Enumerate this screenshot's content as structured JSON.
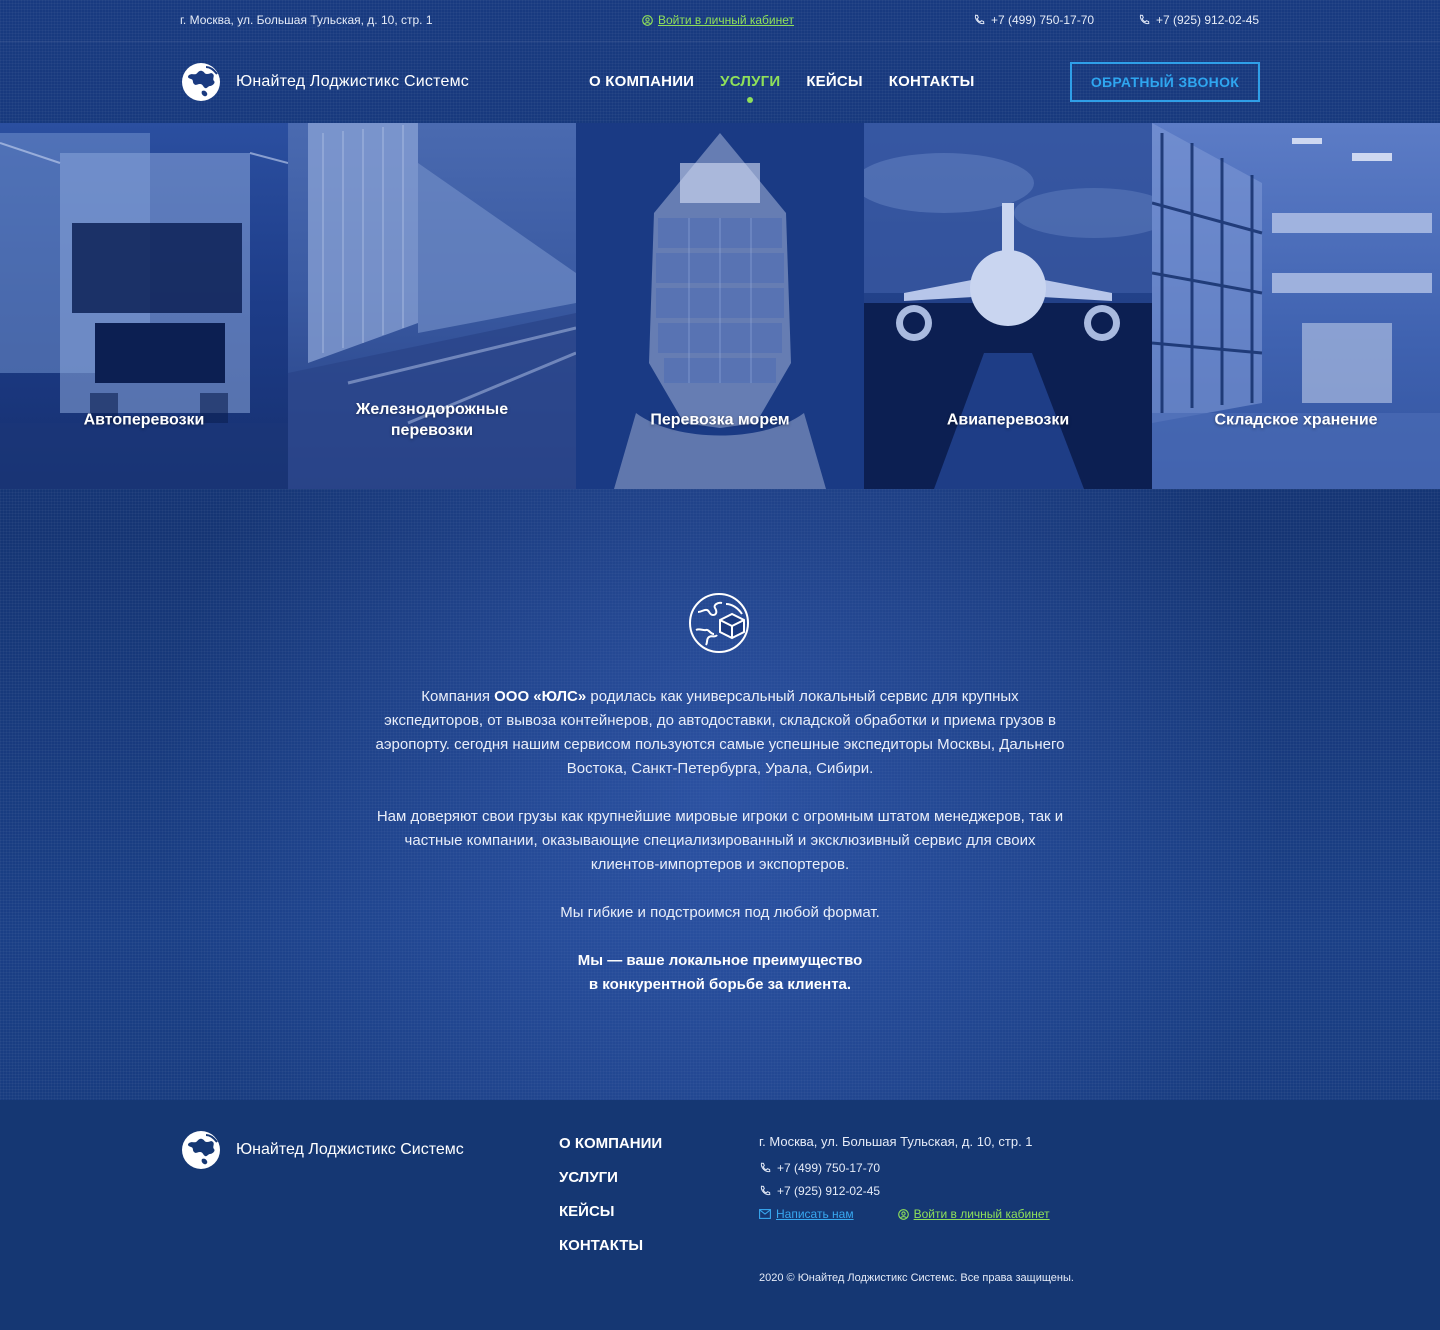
{
  "topbar": {
    "address": "г. Москва, ул. Большая Тульская, д. 10, стр. 1",
    "cabinet_link": "Войти в личный кабинет",
    "phone1": "+7 (499) 750-17-70",
    "phone2": "+7 (925) 912-02-45"
  },
  "header": {
    "logo_text": "Юнайтед Лоджистикс Системс",
    "nav": [
      {
        "label": "О компании",
        "active": false
      },
      {
        "label": "Услуги",
        "active": true
      },
      {
        "label": "Кейсы",
        "active": false
      },
      {
        "label": "Контакты",
        "active": false
      }
    ],
    "callback_label": "Обратный звонок"
  },
  "services": [
    {
      "label": "Автоперевозки"
    },
    {
      "label": "Железнодорожные перевозки"
    },
    {
      "label": "Перевозка морем"
    },
    {
      "label": "Авиаперевозки"
    },
    {
      "label": "Складское хранение"
    }
  ],
  "about": {
    "p1_before": "Компания ",
    "p1_bold": "ООО «ЮЛС»",
    "p1_after": " родилась как универсальный локальный сервис для крупных экспедиторов, от вывоза контейнеров, до автодоставки, складской обработки и приема грузов в аэропорту. сегодня нашим сервисом пользуются самые успешные экспедиторы Москвы, Дальнего Востока, Санкт-Петербурга, Урала, Сибири.",
    "p2": "Нам доверяют свои грузы как крупнейшие мировые игроки с огромным штатом менеджеров, так и частные компании, оказывающие специализированный и эксклюзивный сервис для своих клиентов-импортеров и экспортеров.",
    "p3": "Мы гибкие и подстроимся под любой формат.",
    "p4_line1": "Мы — ваше локальное преимущество",
    "p4_line2": "в конкурентной борьбе за клиента."
  },
  "footer": {
    "logo_text": "Юнайтед Лоджистикс Системс",
    "nav": [
      "О компании",
      "Услуги",
      "Кейсы",
      "Контакты"
    ],
    "address": "г. Москва, ул. Большая Тульская, д. 10, стр. 1",
    "phone1": "+7 (499) 750-17-70",
    "phone2": "+7 (925) 912-02-45",
    "write_link": "Написать нам",
    "cabinet_link": "Войти в личный кабинет",
    "copyright": "2020 © Юнайтед Лоджистикс Системс. Все права защищены."
  },
  "colors": {
    "accent_green": "#8fe05a",
    "accent_blue": "#2fa6f0",
    "background": "#163878",
    "footer": "#153773"
  }
}
